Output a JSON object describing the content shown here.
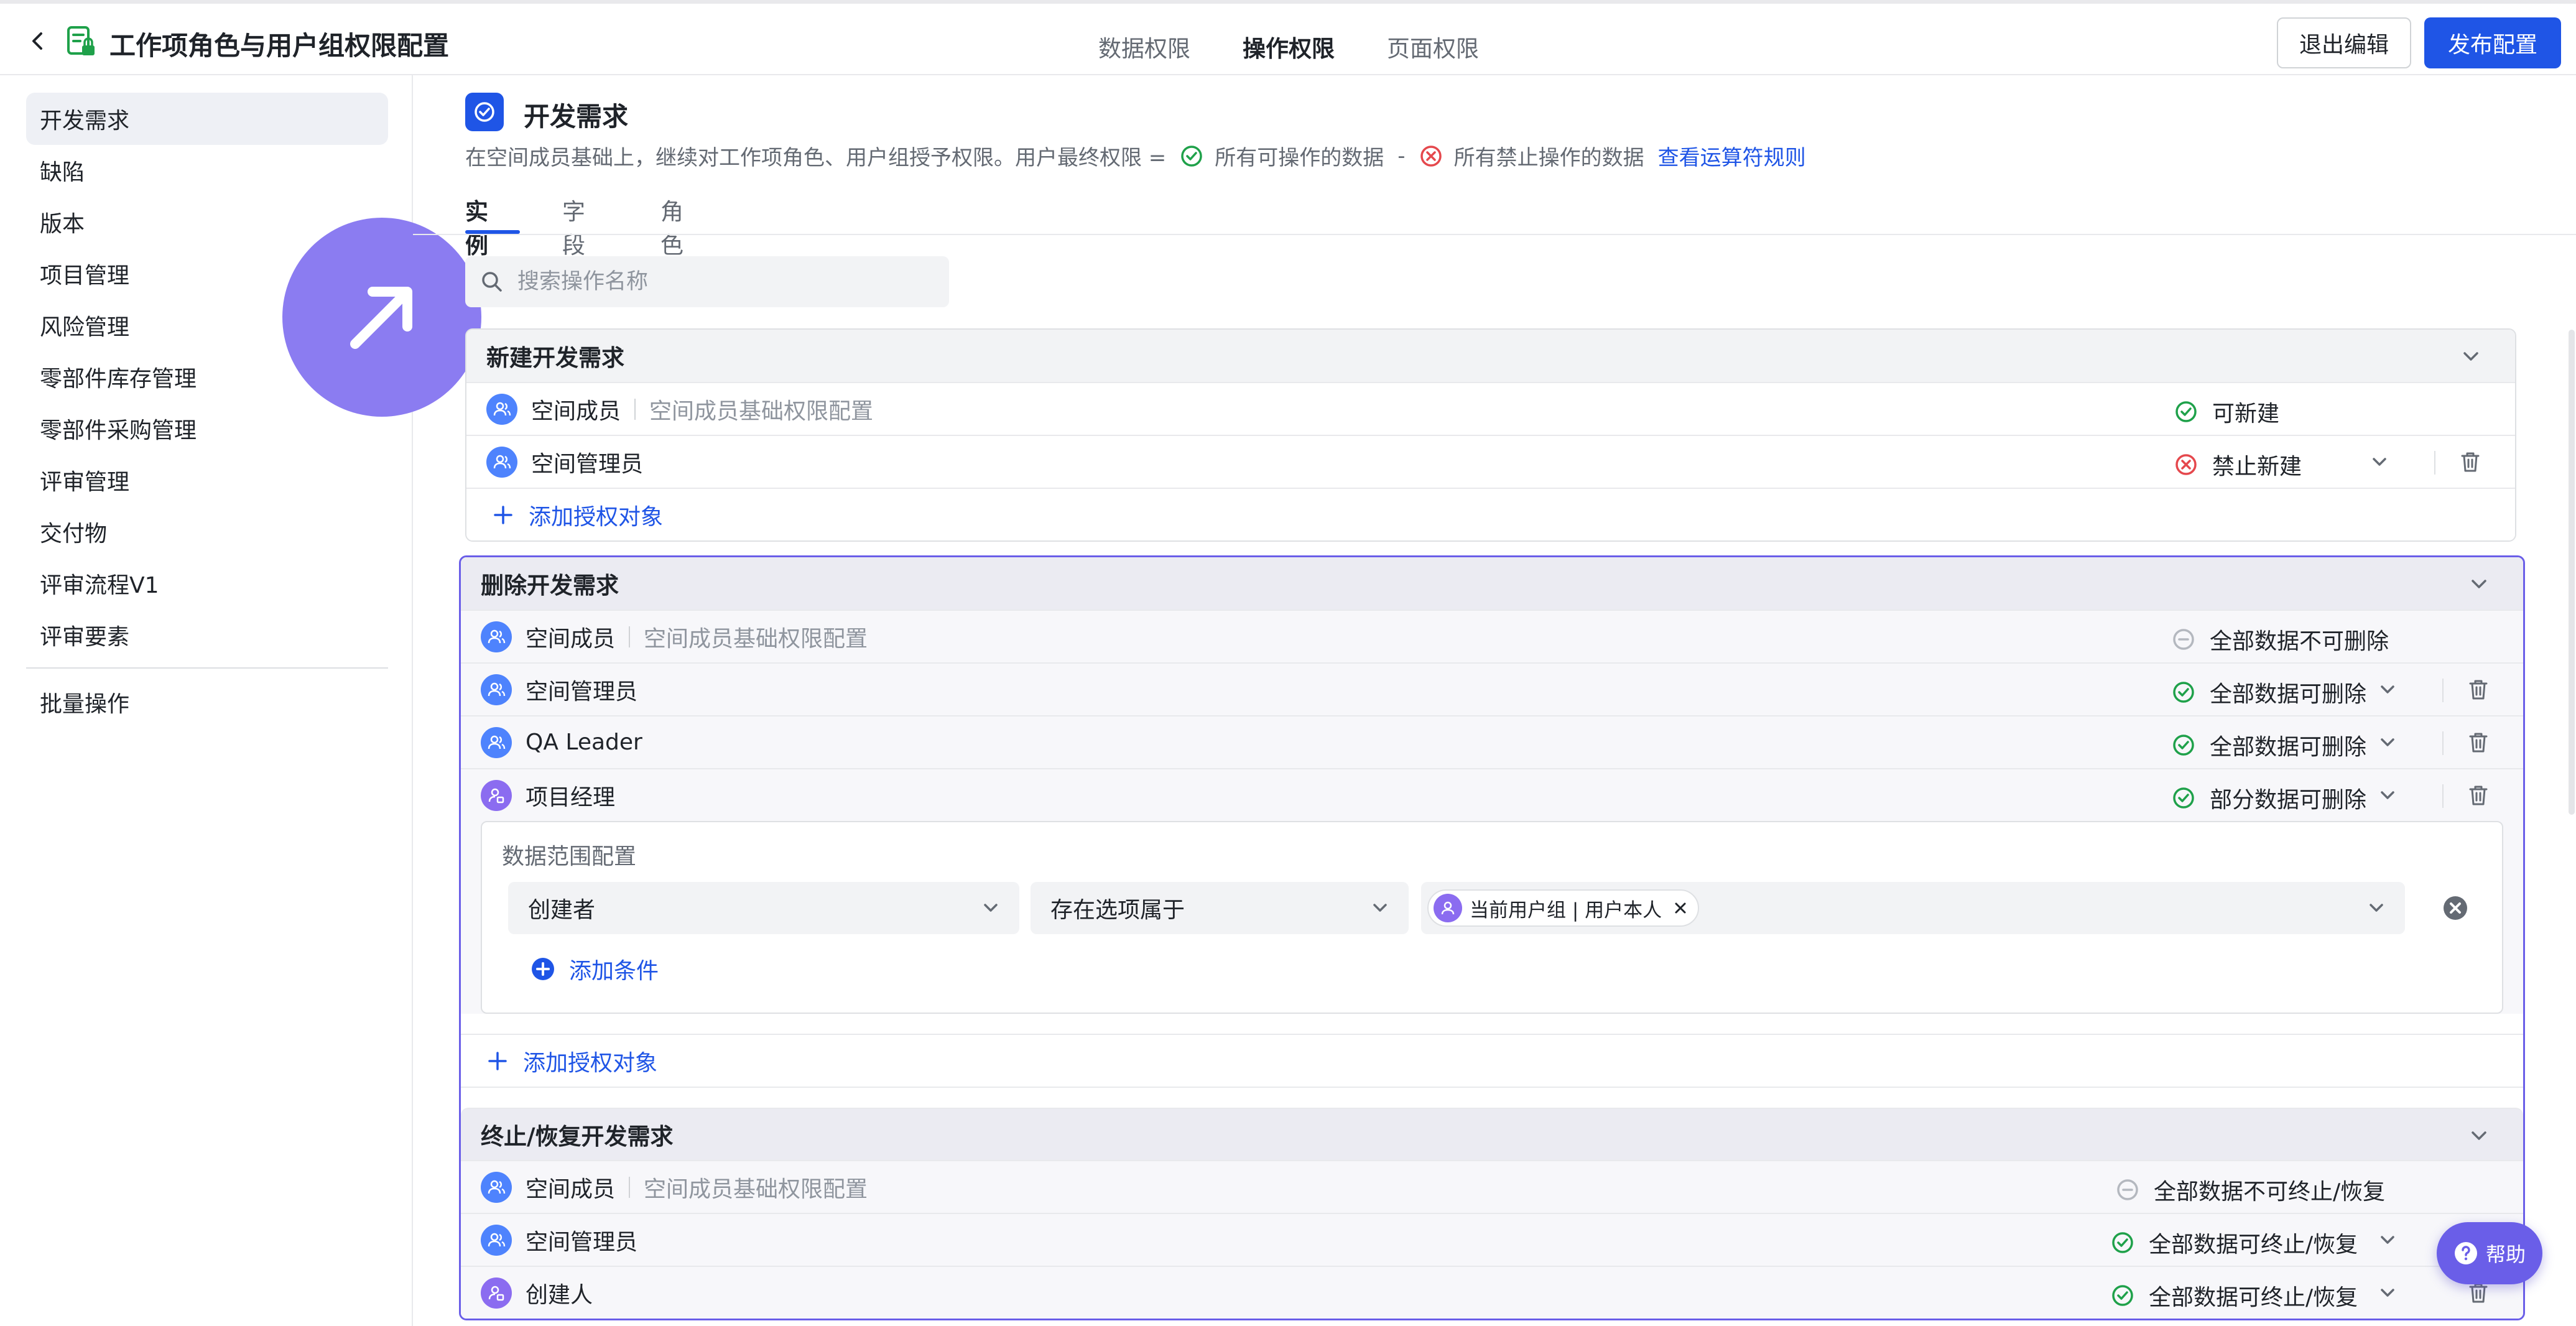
{
  "header": {
    "title": "工作项角色与用户组权限配置",
    "tabs": [
      "数据权限",
      "操作权限",
      "页面权限"
    ],
    "active_tab": "操作权限",
    "exit_label": "退出编辑",
    "publish_label": "发布配置"
  },
  "sidebar": {
    "items": [
      "开发需求",
      "缺陷",
      "版本",
      "项目管理",
      "风险管理",
      "零部件库存管理",
      "零部件采购管理",
      "评审管理",
      "交付物",
      "评审流程V1",
      "评审要素"
    ],
    "bottom_item": "批量操作",
    "active": "开发需求"
  },
  "main": {
    "title": "开发需求",
    "desc_prefix": "在空间成员基础上，继续对工作项角色、用户组授予权限。用户最终权限 =",
    "desc_allow": "所有可操作的数据",
    "desc_minus": "-",
    "desc_deny": "所有禁止操作的数据",
    "desc_link": "查看运算符规则",
    "subtabs": [
      "实例",
      "字段",
      "角色"
    ],
    "search_placeholder": "搜索操作名称"
  },
  "cards": {
    "create": {
      "title": "新建开发需求",
      "rows": [
        {
          "name": "空间成员",
          "note": "空间成员基础权限配置",
          "status": "可新建"
        },
        {
          "name": "空间管理员",
          "status": "禁止新建"
        }
      ],
      "add_label": "添加授权对象"
    },
    "delete": {
      "title": "删除开发需求",
      "rows": [
        {
          "name": "空间成员",
          "note": "空间成员基础权限配置",
          "status": "全部数据不可删除"
        },
        {
          "name": "空间管理员",
          "status": "全部数据可删除"
        },
        {
          "name": "QA Leader",
          "status": "全部数据可删除"
        },
        {
          "name": "项目经理",
          "status": "部分数据可删除"
        }
      ],
      "range": {
        "title": "数据范围配置",
        "field": "创建者",
        "operator": "存在选项属于",
        "value_tag": "当前用户组 | 用户本人",
        "add_condition": "添加条件"
      },
      "add_label": "添加授权对象"
    },
    "terminate": {
      "title": "终止/恢复开发需求",
      "rows": [
        {
          "name": "空间成员",
          "note": "空间成员基础权限配置",
          "status": "全部数据不可终止/恢复"
        },
        {
          "name": "空间管理员",
          "status": "全部数据可终止/恢复"
        },
        {
          "name": "创建人",
          "status": "全部数据可终止/恢复"
        }
      ]
    }
  },
  "help_label": "帮助",
  "colors": {
    "primary": "#1f55e6",
    "success": "#1fa14a",
    "danger": "#e5484d",
    "selected_border": "#6a5ee8",
    "badge": "#8b7cf1"
  }
}
